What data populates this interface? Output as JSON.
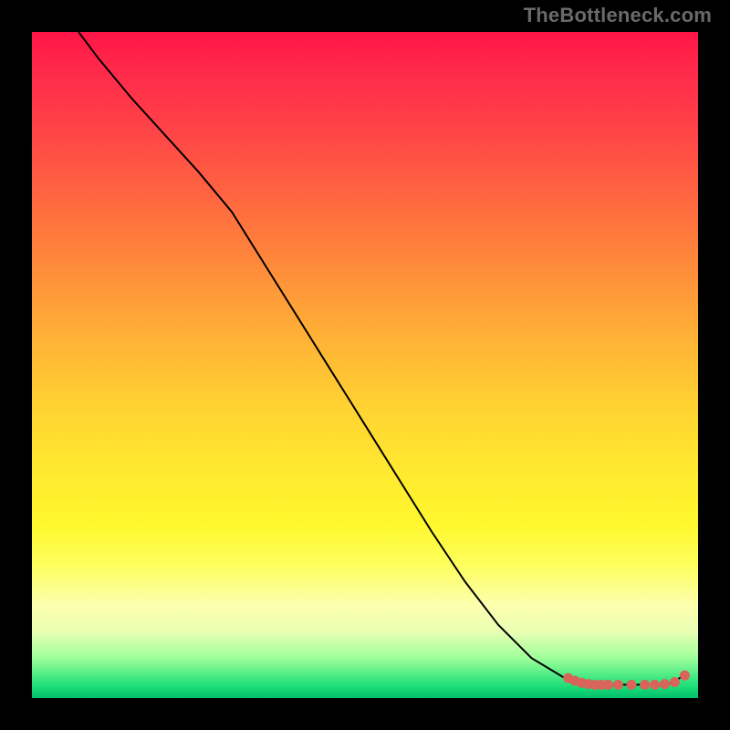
{
  "watermark": "TheBottleneck.com",
  "chart_data": {
    "type": "line",
    "title": "",
    "xlabel": "",
    "ylabel": "",
    "xlim": [
      0,
      100
    ],
    "ylim": [
      0,
      100
    ],
    "grid": false,
    "legend": false,
    "series": [
      {
        "name": "curve",
        "style": "line",
        "color": "#000000",
        "x": [
          7,
          10,
          15,
          20,
          25,
          30,
          35,
          40,
          45,
          50,
          55,
          60,
          65,
          70,
          75,
          80,
          84,
          86,
          88,
          90,
          92,
          94,
          96,
          98
        ],
        "y": [
          100,
          96,
          90,
          84.5,
          79,
          73,
          65,
          57,
          49,
          41,
          33,
          25,
          17.5,
          11,
          6,
          3,
          2,
          2,
          2,
          2,
          2,
          2,
          2.2,
          3.5
        ]
      },
      {
        "name": "markers",
        "style": "scatter",
        "color": "#d9645a",
        "x": [
          80.5,
          81.5,
          82.5,
          83.5,
          84.5,
          85.5,
          86.5,
          88,
          90,
          92,
          93.5,
          95,
          96.5,
          98
        ],
        "y": [
          3.0,
          2.6,
          2.3,
          2.1,
          2.0,
          2.0,
          2.0,
          2.0,
          2.0,
          2.0,
          2.0,
          2.1,
          2.4,
          3.4
        ]
      }
    ]
  }
}
